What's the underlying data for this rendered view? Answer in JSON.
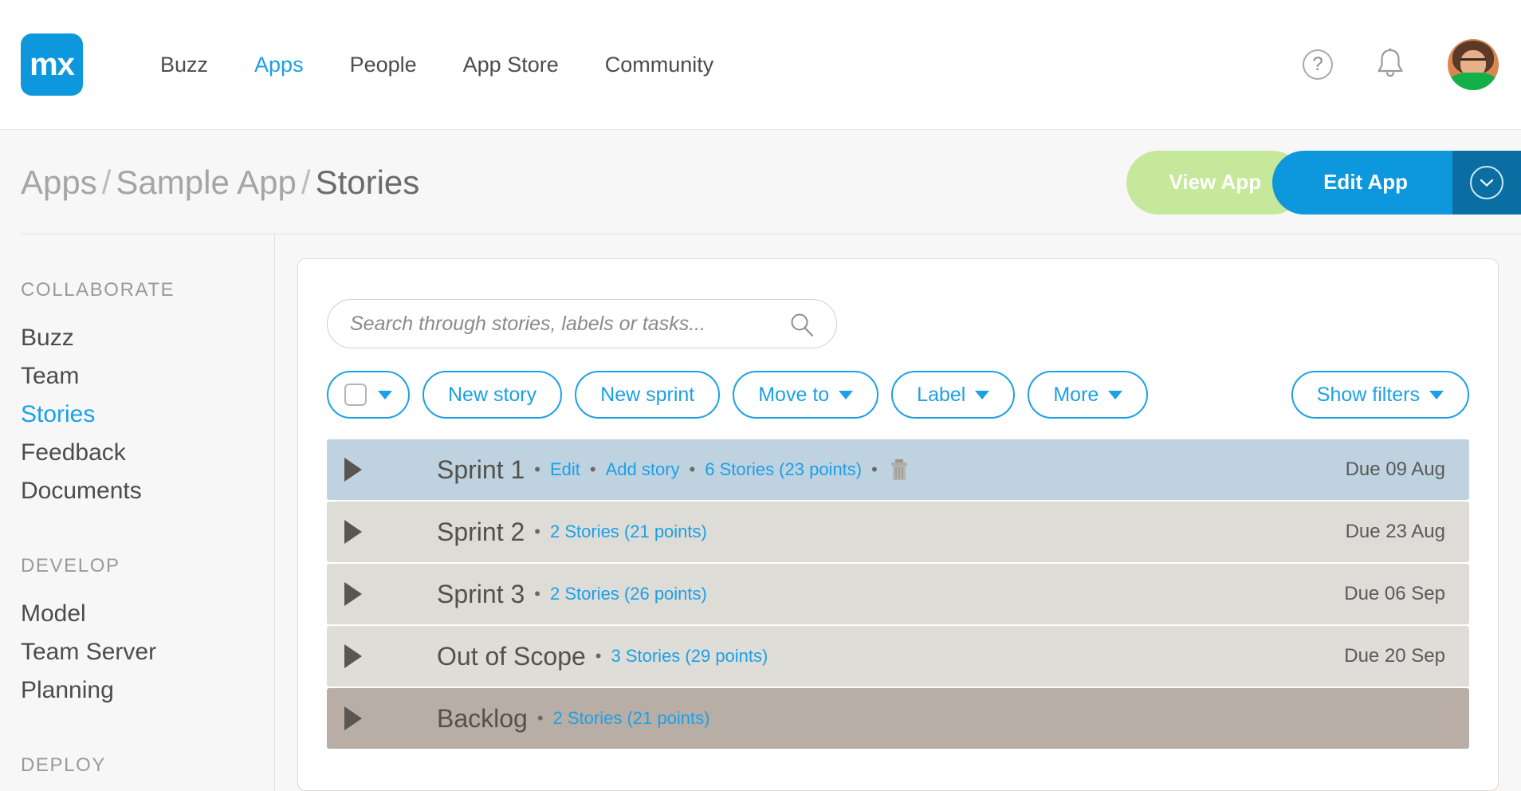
{
  "topnav": {
    "logo_text": "mx",
    "links": [
      {
        "label": "Buzz",
        "active": false
      },
      {
        "label": "Apps",
        "active": true
      },
      {
        "label": "People",
        "active": false
      },
      {
        "label": "App Store",
        "active": false
      },
      {
        "label": "Community",
        "active": false
      }
    ],
    "help_icon": "question-mark-circle-icon",
    "bell_icon": "notification-bell-icon",
    "avatar_icon": "user-avatar"
  },
  "breadcrumb": {
    "part1": "Apps",
    "sep": "/",
    "part2": "Sample App",
    "current": "Stories",
    "view_app_label": "View App",
    "edit_app_label": "Edit App",
    "edit_app_dropdown_icon": "chevron-down-circle-icon"
  },
  "sidebar": {
    "groups": [
      {
        "heading": "COLLABORATE",
        "items": [
          {
            "label": "Buzz",
            "active": false
          },
          {
            "label": "Team",
            "active": false
          },
          {
            "label": "Stories",
            "active": true
          },
          {
            "label": "Feedback",
            "active": false
          },
          {
            "label": "Documents",
            "active": false
          }
        ]
      },
      {
        "heading": "DEVELOP",
        "items": [
          {
            "label": "Model",
            "active": false
          },
          {
            "label": "Team Server",
            "active": false
          },
          {
            "label": "Planning",
            "active": false
          }
        ]
      },
      {
        "heading": "DEPLOY",
        "items": []
      }
    ]
  },
  "search": {
    "placeholder": "Search through stories, labels or tasks...",
    "value": "",
    "icon": "search-icon"
  },
  "toolbar": {
    "select_all_caret": "▼",
    "new_story_label": "New story",
    "new_sprint_label": "New sprint",
    "move_to_label": "Move to",
    "label_label": "Label",
    "more_label": "More",
    "show_filters_label": "Show filters",
    "caret_glyph": "▼"
  },
  "rows": [
    {
      "title": "Sprint 1",
      "links": [
        "Edit",
        "Add story",
        "6 Stories (23 points)"
      ],
      "has_trash": true,
      "due": "Due 09 Aug",
      "bg": "#bed2e0"
    },
    {
      "title": "Sprint 2",
      "links": [
        "2 Stories (21 points)"
      ],
      "has_trash": false,
      "due": "Due 23 Aug",
      "bg": "#dedcd7"
    },
    {
      "title": "Sprint 3",
      "links": [
        "2 Stories (26 points)"
      ],
      "has_trash": false,
      "due": "Due 06 Sep",
      "bg": "#dedcd7"
    },
    {
      "title": "Out of Scope",
      "links": [
        "3 Stories (29 points)"
      ],
      "has_trash": false,
      "due": "Due 20 Sep",
      "bg": "#dfddd8"
    },
    {
      "title": "Backlog",
      "links": [
        "2 Stories (21 points)"
      ],
      "has_trash": false,
      "due": "",
      "bg": "#b8aea6"
    }
  ],
  "colors": {
    "brand_blue": "#0d97dc",
    "link_blue": "#1ca0e8",
    "view_app_green": "#c6e89a",
    "edit_app_dark": "#0a6ea3"
  }
}
